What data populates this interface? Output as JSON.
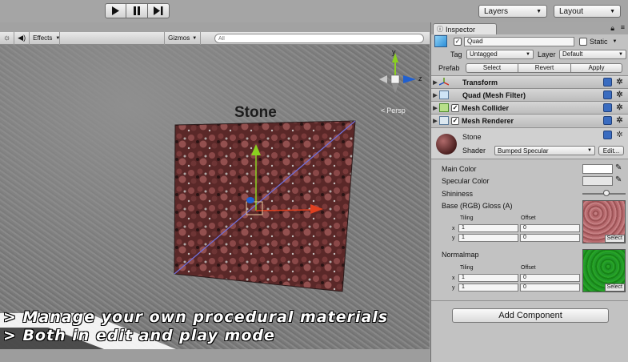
{
  "toolbar": {
    "play_icon": "play-icon",
    "pause_icon": "pause-icon",
    "step_icon": "step-icon",
    "layers_label": "Layers",
    "layout_label": "Layout"
  },
  "scene": {
    "effects_label": "Effects",
    "gizmos_label": "Gizmos",
    "search_placeholder": "All",
    "object_label": "Stone",
    "persp_label": "Persp",
    "gizmo_y": "y",
    "gizmo_x": "x",
    "gizmo_z": "z",
    "caption_line1": "> Manage your own procedural materials",
    "caption_line2": "> Both in edit and play mode"
  },
  "inspector": {
    "tab_label": "Inspector",
    "object_name": "Quad",
    "static_label": "Static",
    "tag_label": "Tag",
    "tag_value": "Untagged",
    "layer_label": "Layer",
    "layer_value": "Default",
    "prefab_label": "Prefab",
    "prefab_buttons": [
      "Select",
      "Revert",
      "Apply"
    ],
    "components": [
      {
        "label": "Transform",
        "checkbox": false
      },
      {
        "label": "Quad (Mesh Filter)",
        "checkbox": false
      },
      {
        "label": "Mesh Collider",
        "checkbox": true
      },
      {
        "label": "Mesh Renderer",
        "checkbox": true
      }
    ],
    "material": {
      "name": "Stone",
      "shader_label": "Shader",
      "shader_value": "Bumped Specular",
      "edit_label": "Edit...",
      "main_color_label": "Main Color",
      "specular_color_label": "Specular Color",
      "shininess_label": "Shininess",
      "shininess_value": 0.55,
      "base_label": "Base (RGB) Gloss (A)",
      "normalmap_label": "Normalmap",
      "tiling_label": "Tiling",
      "offset_label": "Offset",
      "x_label": "x",
      "y_label": "y",
      "base_tiling": [
        "1",
        "1"
      ],
      "base_offset": [
        "0",
        "0"
      ],
      "normal_tiling": [
        "1",
        "1"
      ],
      "normal_offset": [
        "0",
        "0"
      ],
      "select_label": "Select",
      "main_color": "#ffffff",
      "specular_color": "#e6e6e6"
    },
    "add_component_label": "Add Component"
  },
  "colors": {
    "stone_texture": "#7a3a3a",
    "normal_texture": "#1f9a1f",
    "gizmo_y": "#8ad020",
    "gizmo_x": "#e04020",
    "gizmo_z": "#2060d0"
  }
}
